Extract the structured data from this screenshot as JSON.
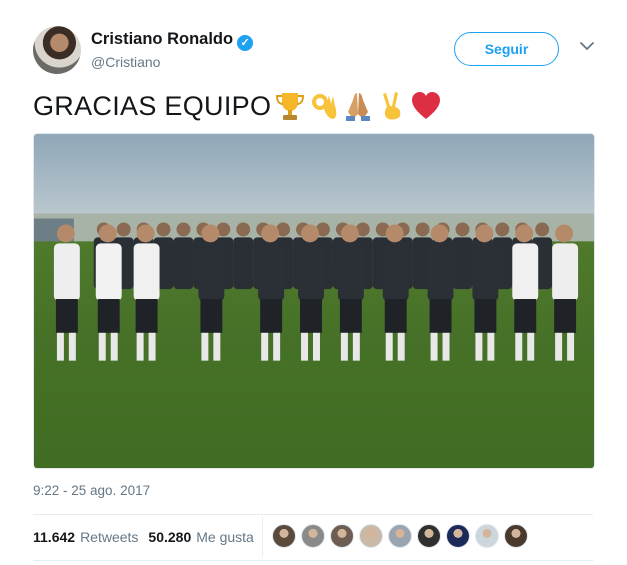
{
  "user": {
    "name": "Cristiano Ronaldo",
    "handle": "@Cristiano",
    "verified": true
  },
  "follow_button": {
    "label": "Seguir"
  },
  "tweet": {
    "text": "GRACIAS EQUIPO",
    "emojis": [
      "trophy-icon",
      "ok-hand-icon",
      "folded-hands-icon",
      "victory-hand-icon",
      "red-heart-icon"
    ],
    "timestamp": "9:22 - 25 ago. 2017"
  },
  "stats": {
    "retweets_count": "11.642",
    "retweets_label": "Retweets",
    "likes_count": "50.280",
    "likes_label": "Me gusta"
  },
  "likers": [
    {
      "color": "#5a4a3c"
    },
    {
      "color": "#8a8a8a"
    },
    {
      "color": "#6d5d52"
    },
    {
      "color": "#c9b9a6"
    },
    {
      "color": "#9aa4b0"
    },
    {
      "color": "#2f2f2f"
    },
    {
      "color": "#1c2a5a"
    },
    {
      "color": "#ccd6dd"
    },
    {
      "color": "#4a3a2e"
    }
  ],
  "colors": {
    "accent": "#1da1f2",
    "muted": "#657786",
    "text": "#14171a"
  }
}
